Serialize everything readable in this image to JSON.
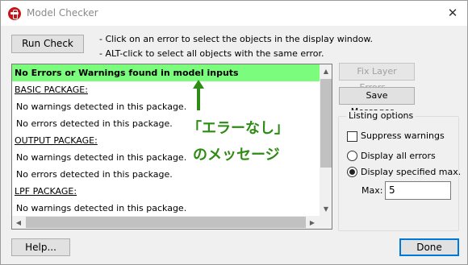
{
  "window": {
    "title": "Model Checker",
    "close_glyph": "✕"
  },
  "toolbar": {
    "run_check_label": "Run Check",
    "instruction_1": "- Click on an error to select the objects in the display window.",
    "instruction_2": "- ALT-click to select all objects with the same error."
  },
  "results": {
    "summary": "No Errors or Warnings found in model inputs",
    "packages": [
      {
        "name": "BASIC PACKAGE:",
        "lines": [
          "No warnings detected in this package.",
          "No errors detected in this package."
        ]
      },
      {
        "name": "OUTPUT PACKAGE:",
        "lines": [
          "No warnings detected in this package.",
          "No errors detected in this package."
        ]
      },
      {
        "name": "LPF PACKAGE:",
        "lines": [
          "No warnings detected in this package."
        ]
      }
    ]
  },
  "annotation": {
    "line_1": "「エラーなし」",
    "line_2": "のメッセージ",
    "color": "#2e8b14"
  },
  "side_buttons": {
    "fix_layer_errors_label": "Fix Layer Errors...",
    "save_messages_label": "Save Messages..."
  },
  "listing_options": {
    "group_label": "Listing options",
    "suppress_warnings_label": "Suppress warnings",
    "suppress_warnings_checked": false,
    "display_all_errors_label": "Display all errors",
    "display_specified_max_label": "Display specified max.",
    "selected_mode": "Display specified max.",
    "max_label": "Max:",
    "max_value": "5"
  },
  "footer": {
    "help_label": "Help...",
    "done_label": "Done"
  },
  "colors": {
    "summary_highlight": "#7cfc7c",
    "app_icon": "#c4161c"
  }
}
